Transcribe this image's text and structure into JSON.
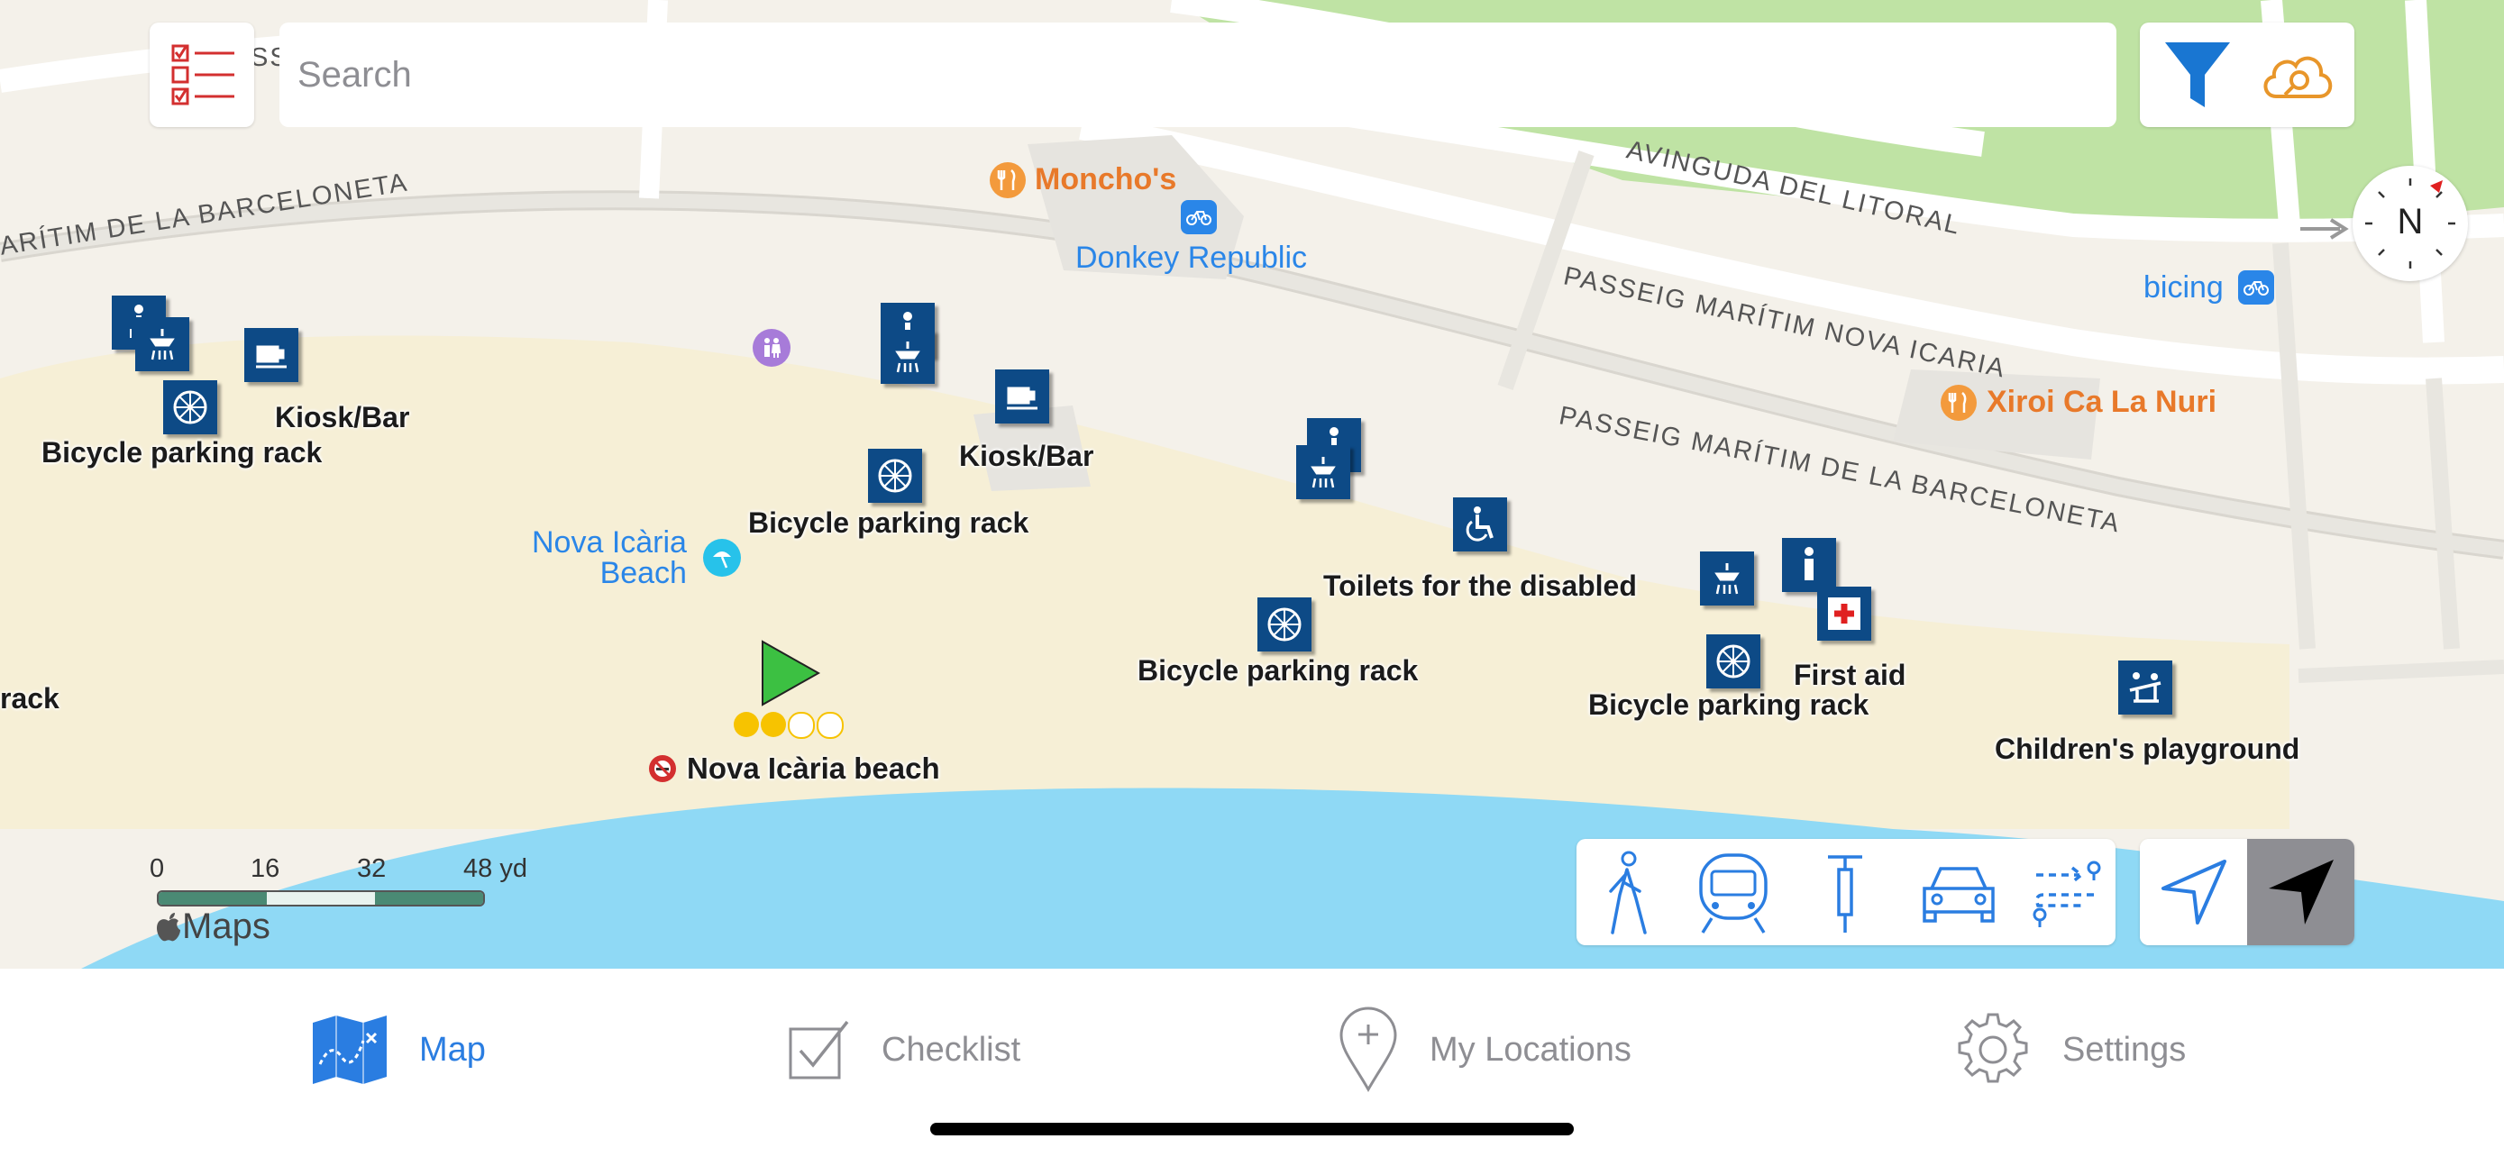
{
  "search": {
    "placeholder": "Search"
  },
  "roads": {
    "avinguda_litoral": "AVINGUDA DEL LITORAL",
    "nova_icaria": "PASSEIG MARÍTIM NOVA ICARIA",
    "barceloneta_left": "ARÍTIM DE LA BARCELONETA",
    "barceloneta_right": "PASSEIG MARÍTIM DE LA BARCELONETA",
    "top_fragment": "SS"
  },
  "places": {
    "monchos": "Moncho's",
    "donkey": "Donkey Republic",
    "bicing": "bicing",
    "xiroi": "Xiroi Ca La Nuri",
    "beach": "Nova Icària\nBeach"
  },
  "poi_labels": {
    "bike1": "Bicycle parking rack",
    "kiosk1": "Kiosk/Bar",
    "bike2": "Bicycle parking rack",
    "kiosk2": "Kiosk/Bar",
    "toilets": "Toilets for the disabled",
    "bike3": "Bicycle parking rack",
    "bike4": "Bicycle parking rack",
    "first_aid": "First aid",
    "playground": "Children's playground",
    "rack_fragment": "rack",
    "beach_name": "Nova Icària beach"
  },
  "rating": {
    "filled": 2,
    "total": 4
  },
  "compass": {
    "label": "N"
  },
  "scale": {
    "labels": [
      "0",
      "16",
      "32",
      "48 yd"
    ]
  },
  "attribution": "Maps",
  "transport_modes": [
    "walk-icon",
    "transit-icon",
    "bike-icon",
    "car-icon",
    "route-icon"
  ],
  "tabs": [
    {
      "label": "Map",
      "icon": "map-icon",
      "active": true
    },
    {
      "label": "Checklist",
      "icon": "checklist-icon",
      "active": false
    },
    {
      "label": "My Locations",
      "icon": "pin-icon",
      "active": false
    },
    {
      "label": "Settings",
      "icon": "gear-icon",
      "active": false
    }
  ],
  "colors": {
    "accent": "#2a7de1",
    "poi": "#0d4a86",
    "sea": "#8fd9f5",
    "sand": "#f6efd6",
    "orange": "#e8792a"
  }
}
